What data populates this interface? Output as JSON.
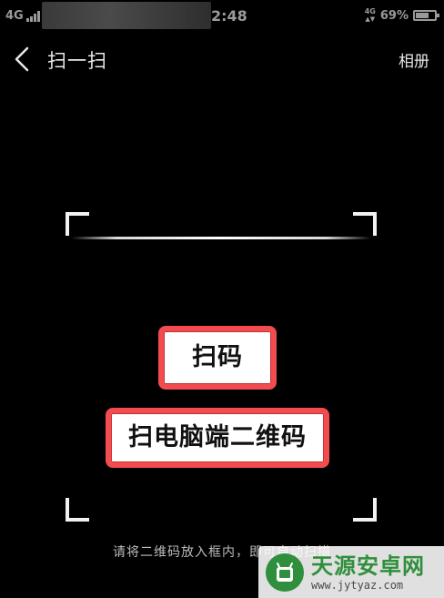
{
  "status_bar": {
    "network_left": "4G",
    "time": "2:48",
    "network_right": "4G",
    "battery_percent": "69%",
    "battery_level": 0.69
  },
  "header": {
    "back_icon": "chevron-left-icon",
    "title": "扫一扫",
    "album_label": "相册"
  },
  "scanner": {
    "hint": "请将二维码放入框内，即可自动扫描"
  },
  "annotations": {
    "box1": "扫码",
    "box2": "扫电脑端二维码",
    "border_color": "#f24c4f"
  },
  "watermark": {
    "logo_icon": "site-logo-icon",
    "name": "天源安卓网",
    "url": "www.jytyaz.com"
  }
}
